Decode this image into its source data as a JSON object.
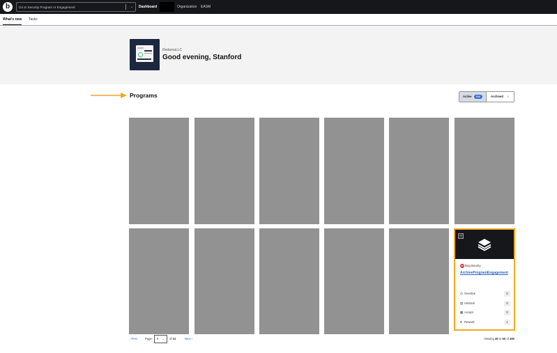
{
  "topbar": {
    "logo_letter": "b",
    "search_placeholder": "Go to Security Program or Engagement",
    "nav": {
      "dashboard": "Dashboard",
      "organization": "Organization",
      "easm": "EASM"
    }
  },
  "subnav": {
    "tabs": [
      "What's new",
      "Tasks"
    ]
  },
  "hero": {
    "org_name": "RedamaLLC",
    "greeting": "Good evening, Stanford"
  },
  "programs": {
    "title": "Programs",
    "filter": {
      "active_label": "Active",
      "active_count": "164",
      "archived_label": "Archived",
      "archived_count": "0"
    },
    "card": {
      "type_label": "Bug Bounty",
      "name": "ArchiveProgramEngagement",
      "stats": [
        {
          "label": "Overdue",
          "value": "0",
          "icon": "clock-icon"
        },
        {
          "label": "Unblock",
          "value": "0",
          "icon": "unblock-icon"
        },
        {
          "label": "Accept",
          "value": "0",
          "icon": "accept-icon"
        },
        {
          "label": "Reward",
          "value": "1",
          "icon": "reward-icon"
        }
      ]
    }
  },
  "pagination": {
    "prev": "‹ Prev",
    "page_label": "Page:",
    "page_value": "5",
    "of_text": "of",
    "total_pages": "41",
    "next": "Next ›",
    "viewing_prefix": "Viewing",
    "range_start": "49",
    "to_text": "to",
    "range_end": "60",
    "of_total_text": "of",
    "total_items": "490"
  },
  "colors": {
    "highlight": "#f5a623",
    "topbar": "#16171a",
    "link": "#2a62c4",
    "placeholder_tile": "#929292"
  }
}
